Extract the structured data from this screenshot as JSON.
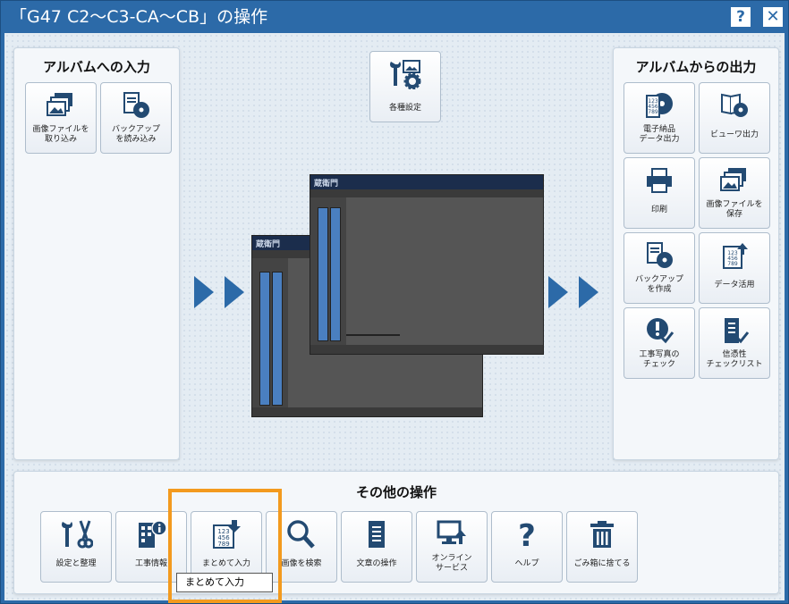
{
  "window": {
    "title": "「G47 C2～C3-CA～CB」の操作",
    "help_label": "?",
    "close_label": "✕"
  },
  "input_panel": {
    "title": "アルバムへの入力",
    "tiles": [
      {
        "label": "画像ファイルを\n取り込み",
        "icon": "images-icon"
      },
      {
        "label": "バックアップ\nを読み込み",
        "icon": "backup-disc-icon"
      }
    ]
  },
  "settings_tile": {
    "label": "各種設定",
    "icon": "settings-tools-icon"
  },
  "output_panel": {
    "title": "アルバムからの出力",
    "tiles": [
      {
        "label": "電子納品\nデータ出力",
        "icon": "disc-numbers-icon"
      },
      {
        "label": "ビューワ出力",
        "icon": "viewer-disc-icon"
      },
      {
        "label": "印刷",
        "icon": "printer-icon"
      },
      {
        "label": "画像ファイルを\n保存",
        "icon": "images-icon"
      },
      {
        "label": "バックアップ\nを作成",
        "icon": "backup-disc-icon"
      },
      {
        "label": "データ活用",
        "icon": "data-export-icon"
      },
      {
        "label": "工事写真の\nチェック",
        "icon": "photo-check-icon"
      },
      {
        "label": "信憑性\nチェックリスト",
        "icon": "checklist-icon"
      }
    ]
  },
  "other_panel": {
    "title": "その他の操作",
    "tiles": [
      {
        "label": "設定と整理",
        "icon": "tools-scissors-icon"
      },
      {
        "label": "工事情報",
        "icon": "building-info-icon"
      },
      {
        "label": "まとめて入力",
        "icon": "batch-input-icon"
      },
      {
        "label": "画像を検索",
        "icon": "search-icon"
      },
      {
        "label": "文章の操作",
        "icon": "document-icon"
      },
      {
        "label": "オンライン\nサービス",
        "icon": "online-upload-icon"
      },
      {
        "label": "ヘルプ",
        "icon": "help-icon"
      },
      {
        "label": "ごみ箱に捨てる",
        "icon": "trash-icon"
      }
    ]
  },
  "tooltip": {
    "text": "まとめて入力"
  },
  "preview": {
    "logo": "蔵衛門",
    "album_label": "G47 C2~C3-CA~CB"
  },
  "colors": {
    "accent": "#2c6aa8",
    "highlight": "#f39a1e",
    "icon": "#234a72"
  }
}
